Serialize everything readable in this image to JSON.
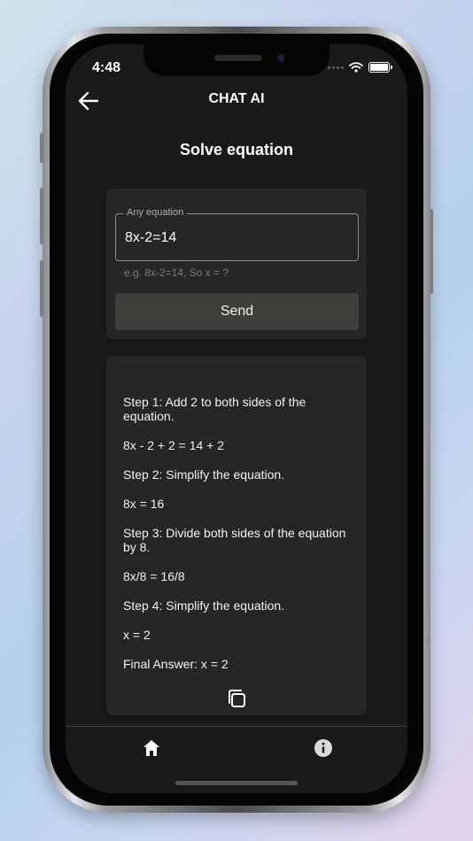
{
  "status_bar": {
    "time": "4:48"
  },
  "app_bar": {
    "title": "CHAT AI",
    "back_icon": "arrow-left-icon"
  },
  "page": {
    "title": "Solve equation"
  },
  "form": {
    "label": "Any equation",
    "value": "8x-2=14",
    "helper": "e.g. 8x-2=14, So x = ?",
    "send_label": "Send"
  },
  "result": {
    "lines": [
      "Step 1: Add 2 to both sides of the equation.",
      "8x - 2 + 2 = 14 + 2",
      "Step 2: Simplify the equation.",
      "8x = 16",
      "Step 3: Divide both sides of the equation by 8.",
      "8x/8 = 16/8",
      "Step 4: Simplify the equation.",
      "x = 2",
      "Final Answer: x = 2"
    ],
    "copy_icon": "copy-icon"
  },
  "bottom_nav": {
    "home_icon": "home-icon",
    "info_icon": "info-icon"
  },
  "colors": {
    "screen_bg": "#1a1a1a",
    "card_bg": "#262626",
    "button_bg": "#3d3f3a",
    "text": "#ffffff"
  }
}
